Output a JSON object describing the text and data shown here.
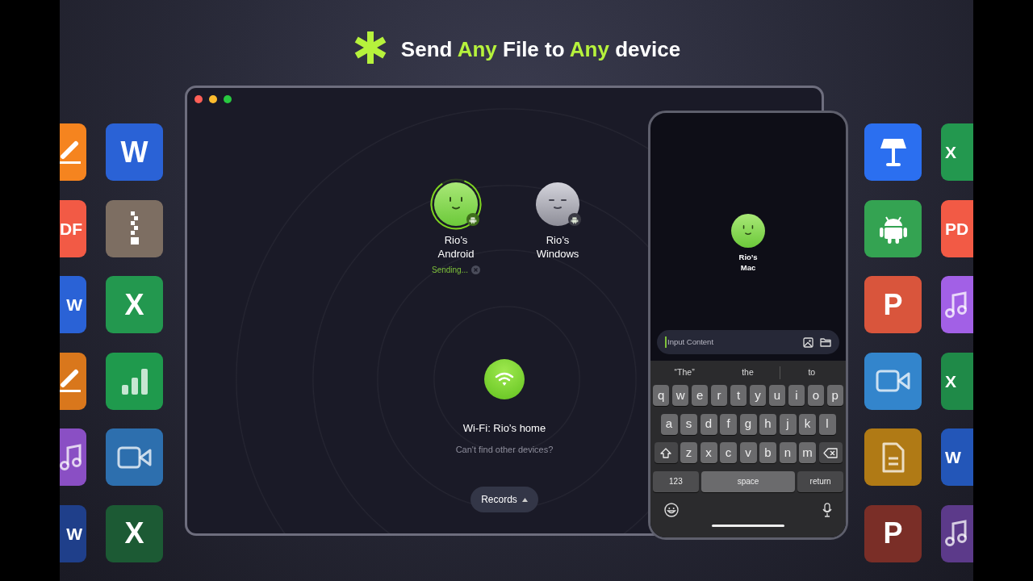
{
  "header": {
    "title": [
      {
        "text": "Send ",
        "highlight": false
      },
      {
        "text": "Any",
        "highlight": true
      },
      {
        "text": " File to ",
        "highlight": false
      },
      {
        "text": "Any",
        "highlight": true
      },
      {
        "text": " device",
        "highlight": false
      }
    ]
  },
  "tiles_left": [
    [
      {
        "kind": "pen",
        "color": "#f5841f"
      },
      {
        "kind": "letter",
        "text": "DF",
        "color": "#f25a45"
      },
      {
        "kind": "letter",
        "text": "W",
        "color": "#2a62d6"
      },
      {
        "kind": "pen",
        "color": "#d9771c"
      },
      {
        "kind": "music",
        "color": "#8a4fc4"
      },
      {
        "kind": "letter",
        "text": "W",
        "color": "#1f3f8a"
      }
    ],
    [
      {
        "kind": "letter",
        "text": "W",
        "color": "#2a62d6"
      },
      {
        "kind": "zip",
        "color": "#7d6e62"
      },
      {
        "kind": "letter",
        "text": "X",
        "color": "#23984f"
      },
      {
        "kind": "bars",
        "color": "#1f9a4d"
      },
      {
        "kind": "video",
        "color": "#2d6fae"
      },
      {
        "kind": "letter",
        "text": "X",
        "color": "#1c5a34"
      }
    ]
  ],
  "tiles_right": [
    [
      {
        "kind": "lamp",
        "color": "#2b6ff0"
      },
      {
        "kind": "android",
        "color": "#34a352"
      },
      {
        "kind": "letter",
        "text": "P",
        "color": "#d9553c"
      },
      {
        "kind": "video",
        "color": "#3385cc"
      },
      {
        "kind": "doc",
        "color": "#b07a15"
      },
      {
        "kind": "letter",
        "text": "P",
        "color": "#7a2e27"
      }
    ],
    [
      {
        "kind": "letter",
        "text": "X",
        "color": "#23984f"
      },
      {
        "kind": "letter",
        "text": "PD",
        "color": "#f25a45"
      },
      {
        "kind": "music",
        "color": "#a260e6"
      },
      {
        "kind": "letter",
        "text": "X",
        "color": "#1f8a48"
      },
      {
        "kind": "letter",
        "text": "W",
        "color": "#2356b8"
      },
      {
        "kind": "music",
        "color": "#5c3a8a"
      }
    ]
  ],
  "desktop_window": {
    "controls": [
      {
        "color": "#ff5f57"
      },
      {
        "color": "#febc2e"
      },
      {
        "color": "#28c840"
      }
    ],
    "devices": [
      {
        "name": "Rio’s Android",
        "online": true,
        "selected": true,
        "level": 0.85,
        "status": "Sending..."
      },
      {
        "name": "Rio’s Windows",
        "online": false,
        "selected": false
      }
    ],
    "network": {
      "label": "Wi-Fi: Rio’s home",
      "help": "Can't find other devices?"
    },
    "records_button": {
      "label": "Records"
    }
  },
  "phone": {
    "device": {
      "name": "Rio’s Mac"
    },
    "input": {
      "placeholder": "Input Content"
    },
    "suggestions": [
      "“The”",
      "the",
      "to"
    ],
    "key_rows": [
      [
        {
          "kind": "char",
          "label": "q"
        },
        {
          "kind": "char",
          "label": "w"
        },
        {
          "kind": "char",
          "label": "e"
        },
        {
          "kind": "char",
          "label": "r"
        },
        {
          "kind": "char",
          "label": "t"
        },
        {
          "kind": "char",
          "label": "y"
        },
        {
          "kind": "char",
          "label": "u"
        },
        {
          "kind": "char",
          "label": "i"
        },
        {
          "kind": "char",
          "label": "o"
        },
        {
          "kind": "char",
          "label": "p"
        }
      ],
      [
        {
          "kind": "char",
          "label": "a"
        },
        {
          "kind": "char",
          "label": "s"
        },
        {
          "kind": "char",
          "label": "d"
        },
        {
          "kind": "char",
          "label": "f"
        },
        {
          "kind": "char",
          "label": "g"
        },
        {
          "kind": "char",
          "label": "h"
        },
        {
          "kind": "char",
          "label": "j"
        },
        {
          "kind": "char",
          "label": "k"
        },
        {
          "kind": "char",
          "label": "l"
        }
      ],
      [
        {
          "kind": "shift"
        },
        {
          "kind": "char",
          "label": "z"
        },
        {
          "kind": "char",
          "label": "x"
        },
        {
          "kind": "char",
          "label": "c"
        },
        {
          "kind": "char",
          "label": "v"
        },
        {
          "kind": "char",
          "label": "b"
        },
        {
          "kind": "char",
          "label": "n"
        },
        {
          "kind": "char",
          "label": "m"
        },
        {
          "kind": "backspace"
        }
      ],
      [
        {
          "kind": "mode",
          "label": "123"
        },
        {
          "kind": "space",
          "label": "space"
        },
        {
          "kind": "return",
          "label": "return"
        }
      ]
    ]
  }
}
